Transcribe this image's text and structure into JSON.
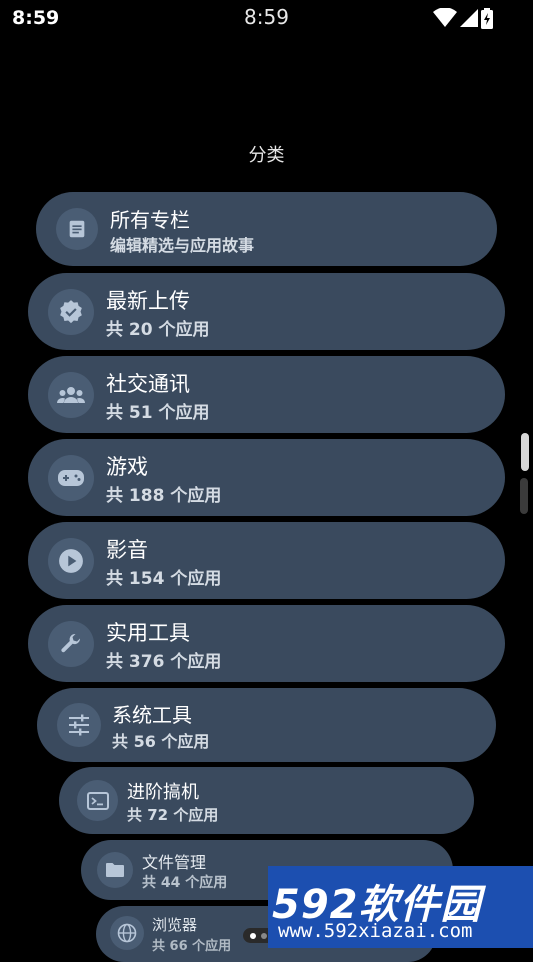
{
  "status_bar": {
    "time_left": "8:59",
    "time_center": "8:59"
  },
  "header": {
    "title": "分类"
  },
  "categories": [
    {
      "name": "所有专栏",
      "subtitle": "编辑精选与应用故事",
      "icon": "article-icon"
    },
    {
      "name": "最新上传",
      "subtitle": "共 20 个应用",
      "icon": "verified-badge-icon"
    },
    {
      "name": "社交通讯",
      "subtitle": "共 51 个应用",
      "icon": "people-group-icon"
    },
    {
      "name": "游戏",
      "subtitle": "共 188 个应用",
      "icon": "gamepad-icon"
    },
    {
      "name": "影音",
      "subtitle": "共 154 个应用",
      "icon": "play-circle-icon"
    },
    {
      "name": "实用工具",
      "subtitle": "共 376 个应用",
      "icon": "wrench-icon"
    },
    {
      "name": "系统工具",
      "subtitle": "共 56 个应用",
      "icon": "sliders-icon"
    },
    {
      "name": "进阶搞机",
      "subtitle": "共 72 个应用",
      "icon": "terminal-icon"
    },
    {
      "name": "文件管理",
      "subtitle": "共 44 个应用",
      "icon": "folder-icon"
    },
    {
      "name": "浏览器",
      "subtitle": "共 66 个应用",
      "icon": "globe-icon"
    }
  ],
  "watermark": {
    "text": "592软件园",
    "url": "www.592xiazai.com"
  },
  "colors": {
    "card": "#3a4a5e",
    "icon_bg": "#4a5d74",
    "background": "#000000",
    "watermark": "#1c4fb0"
  }
}
